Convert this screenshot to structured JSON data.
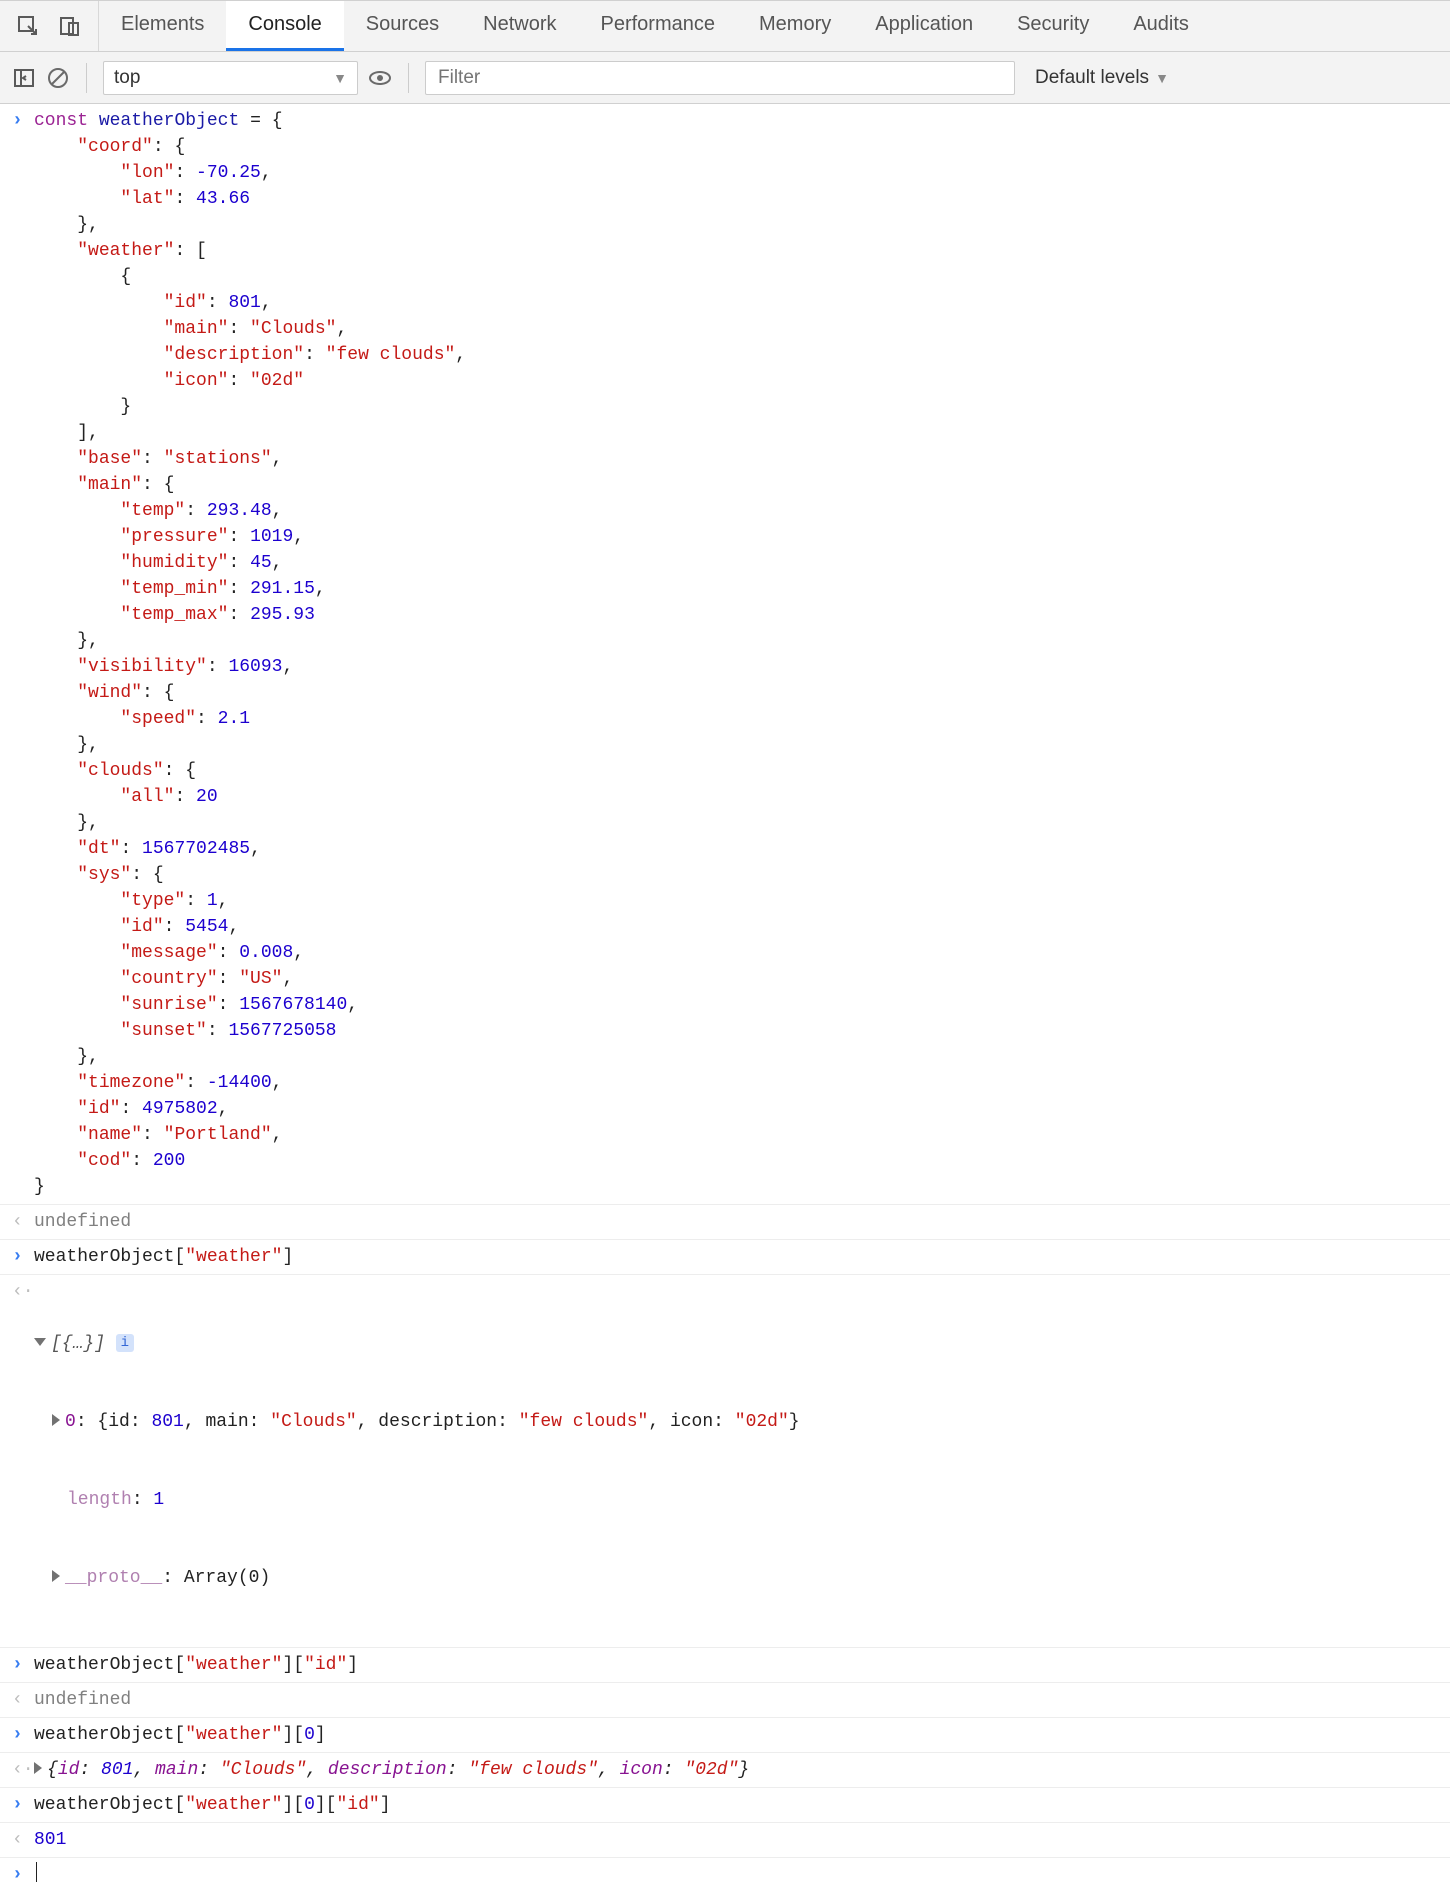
{
  "tabs": [
    "Elements",
    "Console",
    "Sources",
    "Network",
    "Performance",
    "Memory",
    "Application",
    "Security",
    "Audits"
  ],
  "active_tab": "Console",
  "toolbar": {
    "context": "top",
    "filter_placeholder": "Filter",
    "levels": "Default levels"
  },
  "code": {
    "decl_kw": "const",
    "decl_var": "weatherObject",
    "obj": {
      "coord": {
        "lon": -70.25,
        "lat": 43.66
      },
      "weather": [
        {
          "id": 801,
          "main": "Clouds",
          "description": "few clouds",
          "icon": "02d"
        }
      ],
      "base": "stations",
      "main": {
        "temp": 293.48,
        "pressure": 1019,
        "humidity": 45,
        "temp_min": 291.15,
        "temp_max": 295.93
      },
      "visibility": 16093,
      "wind": {
        "speed": 2.1
      },
      "clouds": {
        "all": 20
      },
      "dt": 1567702485,
      "sys": {
        "type": 1,
        "id": 5454,
        "message": 0.008,
        "country": "US",
        "sunrise": 1567678140,
        "sunset": 1567725058
      },
      "timezone": -14400,
      "id": 4975802,
      "name": "Portland",
      "cod": 200
    }
  },
  "outputs": {
    "undef": "undefined",
    "expr2": "weatherObject[\"weather\"]",
    "arr_preview": "[{…}]",
    "arr_item0_id": 801,
    "arr_item0_main": "Clouds",
    "arr_item0_desc": "few clouds",
    "arr_item0_icon": "02d",
    "arr_length_label": "length",
    "arr_length": 1,
    "arr_proto_label": "__proto__",
    "arr_proto_val": "Array(0)",
    "expr3": "weatherObject[\"weather\"][\"id\"]",
    "expr4": "weatherObject[\"weather\"][0]",
    "obj_preview_id": 801,
    "obj_preview_main": "Clouds",
    "obj_preview_desc": "few clouds",
    "obj_preview_icon": "02d",
    "expr5": "weatherObject[\"weather\"][0][\"id\"]",
    "result5": 801
  }
}
